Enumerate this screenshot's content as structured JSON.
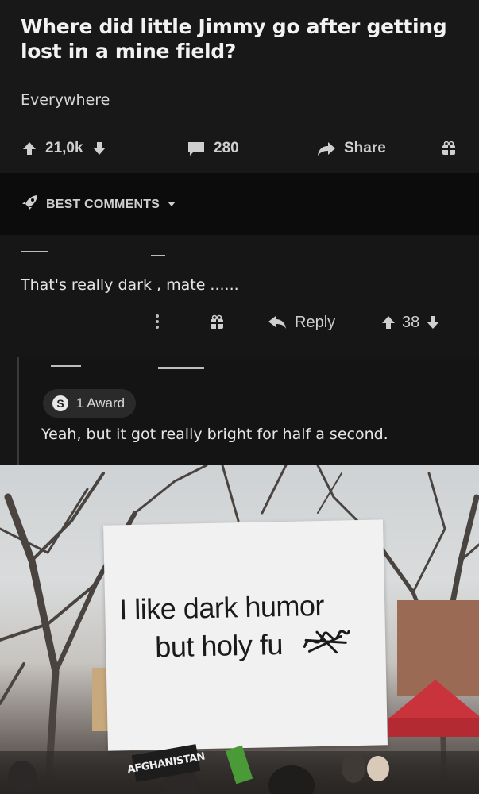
{
  "post": {
    "title": "Where did little Jimmy go after getting lost in a mine field?",
    "body": "Everywhere",
    "upvotes": "21,0k",
    "comments": "280",
    "share_label": "Share"
  },
  "section": {
    "label": "BEST COMMENTS"
  },
  "comments": [
    {
      "text": "That's really dark , mate ......",
      "reply_label": "Reply",
      "score": "38"
    },
    {
      "award": "1 Award",
      "award_coin": "S",
      "text": "Yeah, but it got really bright for half a second."
    }
  ],
  "image": {
    "sign_line1": "I like dark humor",
    "sign_line2": "but holy fu",
    "background_sign": "AFGHANISTAN"
  },
  "colors": {
    "background": "#161616",
    "text": "#e8e8e8",
    "sign": "#f1f1f1"
  }
}
